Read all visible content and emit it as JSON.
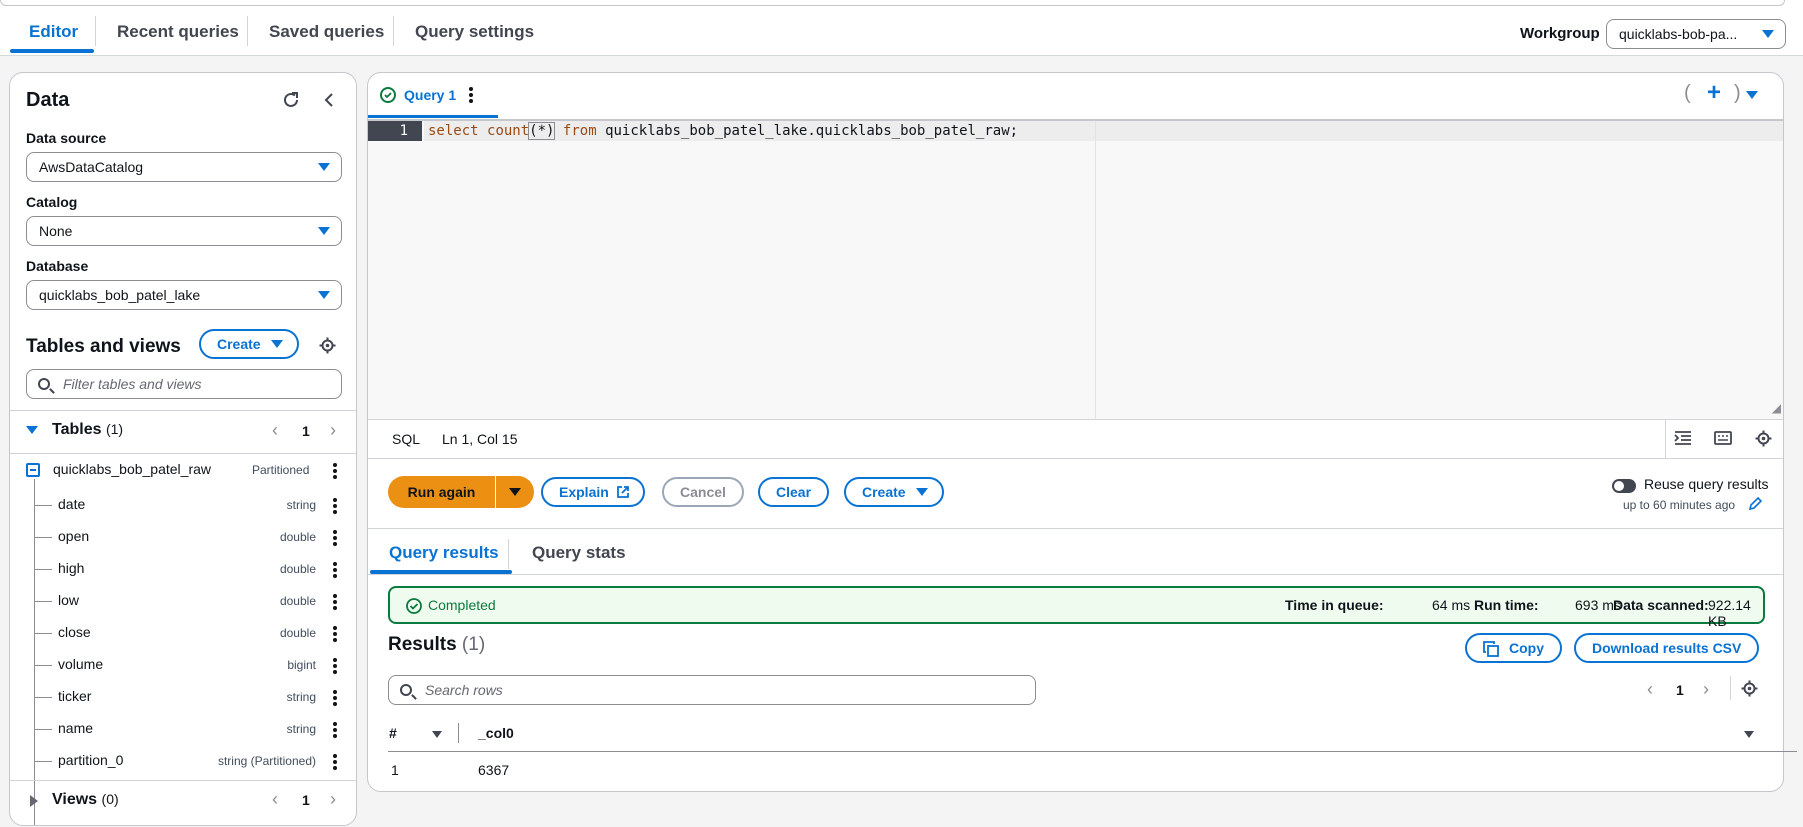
{
  "top_tabs": [
    "Editor",
    "Recent queries",
    "Saved queries",
    "Query settings"
  ],
  "workgroup": {
    "label": "Workgroup",
    "value": "quicklabs-bob-pa..."
  },
  "data_panel": {
    "title": "Data",
    "data_source": {
      "label": "Data source",
      "value": "AwsDataCatalog"
    },
    "catalog": {
      "label": "Catalog",
      "value": "None"
    },
    "database": {
      "label": "Database",
      "value": "quicklabs_bob_patel_lake"
    },
    "tables_views_title": "Tables and views",
    "create_label": "Create",
    "filter_placeholder": "Filter tables and views",
    "tables": {
      "label": "Tables",
      "count": "(1)",
      "page": "1"
    },
    "table": {
      "name": "quicklabs_bob_patel_raw",
      "badge": "Partitioned"
    },
    "columns": [
      {
        "name": "date",
        "type": "string"
      },
      {
        "name": "open",
        "type": "double"
      },
      {
        "name": "high",
        "type": "double"
      },
      {
        "name": "low",
        "type": "double"
      },
      {
        "name": "close",
        "type": "double"
      },
      {
        "name": "volume",
        "type": "bigint"
      },
      {
        "name": "ticker",
        "type": "string"
      },
      {
        "name": "name",
        "type": "string"
      },
      {
        "name": "partition_0",
        "type": "string (Partitioned)"
      }
    ],
    "views": {
      "label": "Views",
      "count": "(0)",
      "page": "1"
    }
  },
  "query_tab": {
    "label": "Query 1"
  },
  "editor": {
    "line_number": "1",
    "code_kw1": "select",
    "code_fn": "count",
    "code_args": "(*)",
    "code_kw2": "from",
    "code_rest": "quicklabs_bob_patel_lake.quicklabs_bob_patel_raw;"
  },
  "status_bar": {
    "language": "SQL",
    "cursor": "Ln 1, Col 15"
  },
  "actions": {
    "run": "Run again",
    "explain": "Explain",
    "cancel": "Cancel",
    "clear": "Clear",
    "create": "Create",
    "reuse_label": "Reuse query results",
    "reuse_sub": "up to 60 minutes ago"
  },
  "result_tabs": [
    "Query results",
    "Query stats"
  ],
  "status": {
    "text": "Completed",
    "queue_label": "Time in queue:",
    "queue_value": "64 ms",
    "run_label": "Run time:",
    "run_value": "693 ms",
    "scanned_label": "Data scanned:",
    "scanned_value": "922.14 KB"
  },
  "results": {
    "title": "Results",
    "count": "(1)",
    "copy": "Copy",
    "download": "Download results CSV",
    "search_placeholder": "Search rows",
    "page": "1",
    "columns": [
      "#",
      "_col0"
    ],
    "rows": [
      {
        "num": "1",
        "value": "6367"
      }
    ]
  }
}
